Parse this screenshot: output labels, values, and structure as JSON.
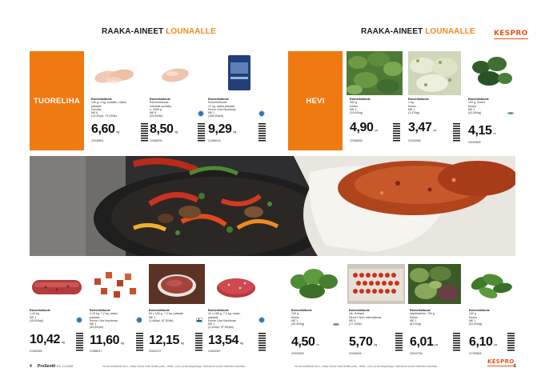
{
  "header": {
    "left": {
      "title_main": "RAAKA-AINEET",
      "title_accent": "LOUNAALLE"
    },
    "right": {
      "title_main": "RAAKA-AINEET",
      "title_accent": "LOUNAALLE"
    },
    "logo": "KESPRO"
  },
  "categories": {
    "tuoreliha": "TUORELIHA",
    "hevi": "HEVI"
  },
  "colors": {
    "accent": "#f07a12",
    "logo": "#e8541c",
    "title_accent": "#f28b1a"
  },
  "top_left_products": [
    {
      "label": "Esimerkkituote",
      "lines": [
        "140 g, 2 kg, suolattu, raaka,",
        "pakaste",
        "Norvida",
        "ME 6",
        "(13,20/ps, 79,20/ltk)"
      ],
      "price": "6,60",
      "unit": "kg",
      "code": "22048501"
    },
    {
      "label": "Esimerkkituote",
      "lines": [
        "Esimerkkituote",
        "miedoist suolattu,",
        "n. 3000 g",
        "ME 6",
        "(25,50/ltk)"
      ],
      "price": "8,50",
      "unit": "kg",
      "code": "21565205"
    },
    {
      "label": "Esimerkkituote",
      "lines": [
        "Esimerkkituote",
        "17 kg, raaka pakaste",
        "Kevon Liha Kauriimas",
        "ME 1",
        "(158,00/pkt)"
      ],
      "price": "9,29",
      "unit": "kg",
      "code": "21988216"
    }
  ],
  "top_right_products": [
    {
      "label": "Esimerkkituote",
      "lines": [
        "350 g",
        "Kesko",
        "ME 1",
        "(14,00/kg)"
      ],
      "price": "4,90",
      "unit": "ps",
      "code": "22058838"
    },
    {
      "label": "Esimerkkituote",
      "lines": [
        "1 kg",
        "Kesko",
        "ME 1",
        "(3,47/kg)"
      ],
      "price": "3,47",
      "unit": "ps",
      "code": "22033466"
    },
    {
      "label": "Esimerkkituote",
      "lines": [
        "100 g, Suomi",
        "Kesko",
        "ME 1",
        "(41,50/kg)"
      ],
      "price": "4,15",
      "unit": "rs",
      "code": "20939925"
    }
  ],
  "bottom_left_products": [
    {
      "label": "Esimerkkituote",
      "lines": [
        "1,44 kg",
        "ME 1",
        "(15,00/kpl)"
      ],
      "price": "10,42",
      "unit": "kg",
      "code": "21983346"
    },
    {
      "label": "Esimerkkituote",
      "lines": [
        "4,15 kg, 7,2 kg, raaka,",
        "pakaste",
        "Kevon Liha Kauriimas",
        "ME 1",
        "(83,50/pkt)"
      ],
      "price": "11,60",
      "unit": "kg",
      "code": "21988217"
    },
    {
      "label": "Esimerkkituote",
      "lines": [
        "60 x 150 g, 7,2 kg, pakaste",
        "ME 1",
        "(1,46/kpl, 87,50/ltk)"
      ],
      "price": "12,15",
      "unit": "kg",
      "code": "20542127"
    },
    {
      "label": "Esimerkkituote",
      "lines": [
        "40 x 180 g, 7,2 kg, raaka,",
        "pakaste",
        "Kevon Liha Kauriimas",
        "ME 1",
        "(2,44/kpl, 97,50/pkt)"
      ],
      "price": "13,54",
      "unit": "kg",
      "code": "21825267"
    }
  ],
  "bottom_right_products": [
    {
      "label": "Esimerkkituote",
      "lines": [
        "100 g",
        "Kesko",
        "ME 1",
        "(45,00/kg)"
      ],
      "price": "4,50",
      "unit": "rs",
      "code": "20939926"
    },
    {
      "label": "Esimerkkituote",
      "lines": [
        "1tk, Hollanti",
        "Direct Fresh International",
        "ME 5",
        "(17,10/ltk)"
      ],
      "price": "5,70",
      "unit": "kg",
      "code": "22046009"
    },
    {
      "label": "Esimerkkituote",
      "lines": [
        "käyttövalmis, 750 g",
        "Kesko",
        "ME 1",
        "(8,01/kg)"
      ],
      "price": "6,01",
      "unit": "ps",
      "code": "20620756"
    },
    {
      "label": "Esimerkkituote",
      "lines": [
        "100 g",
        "Kesko",
        "ME 1",
        "(61,00/kg)"
      ],
      "price": "6,10",
      "unit": "ps",
      "code": "21759828"
    }
  ],
  "footer": {
    "left_page": "4",
    "right_page": "5",
    "brand": "ProSentti",
    "date": "8.5.-1.9.2025",
    "note": "Hinnat sisältävät alv:n, mutta hinnat eivät sisällä pullo-, tölkki-, korii- ja kierrätyskuluja. Valikoimat voivat vaihdella tukuittain."
  }
}
